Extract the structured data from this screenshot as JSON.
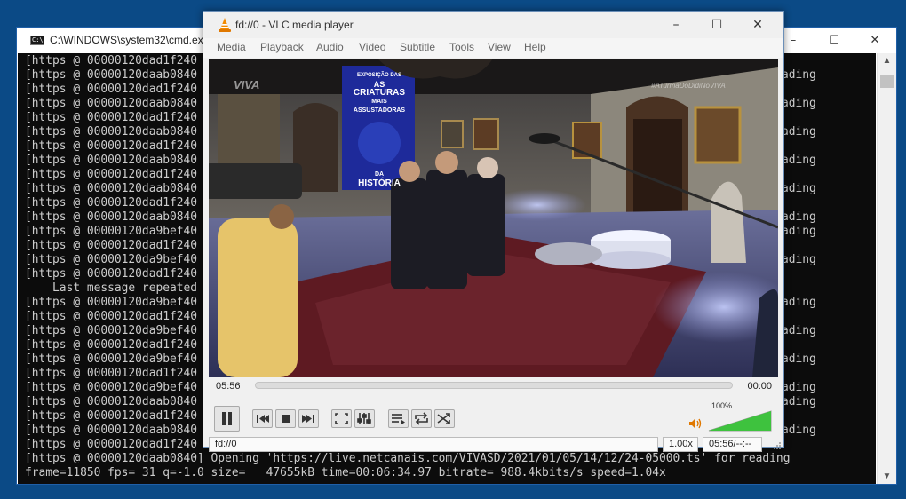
{
  "cmd": {
    "title": "C:\\WINDOWS\\system32\\cmd.exe",
    "icon": "cmd-icon",
    "caption_buttons": [
      "–",
      "☐",
      "✕"
    ],
    "lines": [
      "[https @ 00000120dad1f240",
      "[https @ 00000120daab0840",
      "[https @ 00000120dad1f240",
      "[https @ 00000120daab0840",
      "[https @ 00000120dad1f240",
      "[https @ 00000120daab0840",
      "[https @ 00000120dad1f240",
      "[https @ 00000120daab0840",
      "[https @ 00000120dad1f240",
      "[https @ 00000120daab0840",
      "[https @ 00000120dad1f240",
      "[https @ 00000120daab0840",
      "[https @ 00000120da9bef40",
      "[https @ 00000120dad1f240",
      "[https @ 00000120da9bef40",
      "[https @ 00000120dad1f240",
      "    Last message repeated",
      "[https @ 00000120da9bef40",
      "[https @ 00000120dad1f240",
      "[https @ 00000120da9bef40",
      "[https @ 00000120dad1f240",
      "[https @ 00000120da9bef40",
      "[https @ 00000120dad1f240",
      "[https @ 00000120da9bef40",
      "[https @ 00000120daab0840",
      "[https @ 00000120dad1f240",
      "[https @ 00000120daab0840",
      "[https @ 00000120dad1f240",
      "[https @ 00000120daab0840] Opening 'https://live.netcanais.com/VIVASD/2021/01/05/14/12/24-05000.ts' for reading",
      "frame=11850 fps= 31 q=-1.0 size=   47655kB time=00:06:34.97 bitrate= 988.4kbits/s speed=1.04x"
    ],
    "right_column": [
      "",
      "ading",
      "",
      "ading",
      "",
      "ading",
      "",
      "ading",
      "",
      "ading",
      "",
      "ading",
      "ading",
      "",
      "ading",
      "",
      "",
      "ading",
      "",
      "ading",
      "",
      "ading",
      "",
      "ading",
      "ading",
      "",
      "ading",
      "",
      "",
      ""
    ]
  },
  "vlc": {
    "title": "fd://0 - VLC media player",
    "icon": "vlc-cone-icon",
    "caption_buttons": [
      "–",
      "☐",
      "✕"
    ],
    "menu": [
      "Media",
      "Playback",
      "Audio",
      "Video",
      "Subtitle",
      "Tools",
      "View",
      "Help"
    ],
    "video": {
      "watermark_left": "VIVA",
      "watermark_right": "#ATurmaDoDidiNoVIVA",
      "banner_lines": [
        "EXPOSIÇÃO DAS",
        "AS",
        "CRIATURAS",
        "MAIS",
        "ASSUSTADORAS",
        "DA",
        "HISTÓRIA"
      ]
    },
    "elapsed": "05:56",
    "remaining": "00:00",
    "playback_progress": 0.0,
    "controls": [
      "pause-icon",
      "previous-icon",
      "stop-icon",
      "next-icon",
      "fullscreen-icon",
      "extended-settings-icon",
      "playlist-icon",
      "loop-icon",
      "shuffle-icon"
    ],
    "volume_percent": "100%",
    "volume_level": 1.0,
    "status": {
      "media": "fd://0",
      "speed": "1.00x",
      "time": "05:56/--:--"
    }
  }
}
